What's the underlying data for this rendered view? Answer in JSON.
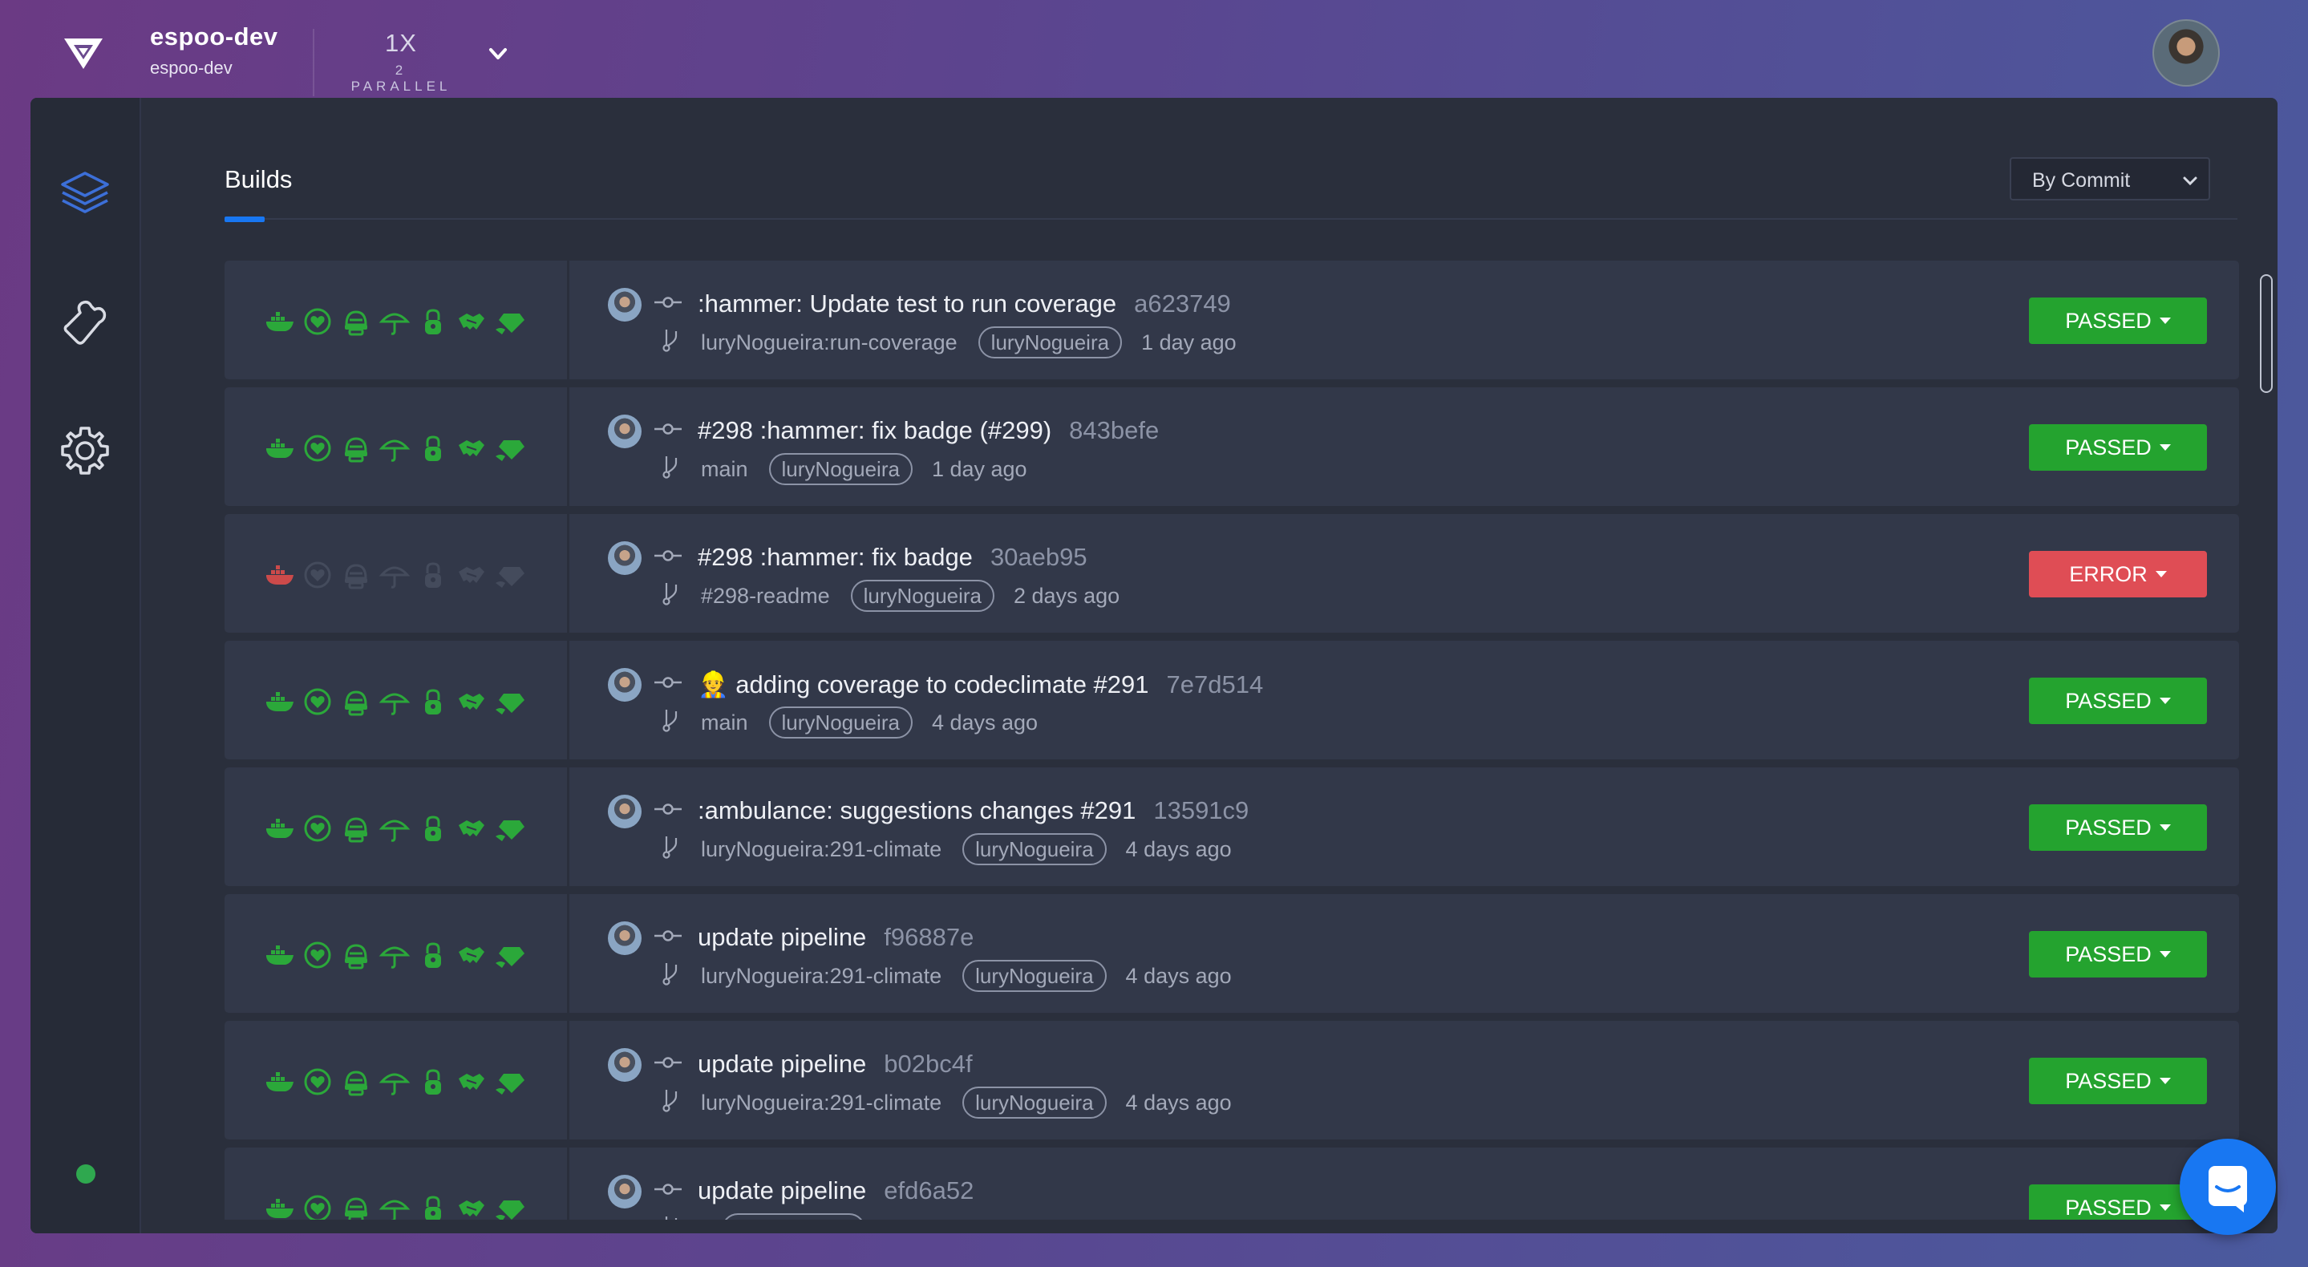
{
  "header": {
    "org_name": "espoo-dev",
    "org_sub": "espoo-dev",
    "plan_main": "1X",
    "plan_sub": "2 PARALLEL",
    "logo_icon": "heart-shield-logo-icon",
    "chevron_icon": "chevron-down-icon",
    "avatar": "user-avatar"
  },
  "sidebar": {
    "items": [
      {
        "icon": "layers-icon",
        "name": "builds",
        "active": true
      },
      {
        "icon": "puzzle-icon",
        "name": "integrations",
        "active": false
      },
      {
        "icon": "gear-icon",
        "name": "settings",
        "active": false
      }
    ],
    "status_color": "#2fa84f"
  },
  "main": {
    "tab_label": "Builds",
    "sort_select": {
      "value": "By Commit"
    }
  },
  "colors": {
    "passed": "#24a32f",
    "error": "#df4d55",
    "stage_ok": "#2ba83a",
    "stage_fail": "#cc4a4a",
    "stage_skipped": "#444b5c",
    "accent": "#1877f2"
  },
  "pipeline_stage_icons": [
    "docker-icon",
    "heart-shield-icon",
    "helmet-icon",
    "umbrella-icon",
    "lock-icon",
    "handshake-icon",
    "diamond-hand-icon"
  ],
  "builds": [
    {
      "message": ":hammer: Update test to run coverage",
      "sha": "a623749",
      "branch": "luryNogueira:run-coverage",
      "user": "luryNogueira",
      "when": "1 day ago",
      "status": "PASSED",
      "stages": [
        "ok",
        "ok",
        "ok",
        "ok",
        "ok",
        "ok",
        "ok"
      ]
    },
    {
      "message": "#298 :hammer: fix badge (#299)",
      "sha": "843befe",
      "branch": "main",
      "user": "luryNogueira",
      "when": "1 day ago",
      "status": "PASSED",
      "stages": [
        "ok",
        "ok",
        "ok",
        "ok",
        "ok",
        "ok",
        "ok"
      ]
    },
    {
      "message": "#298 :hammer: fix badge",
      "sha": "30aeb95",
      "branch": "#298-readme",
      "user": "luryNogueira",
      "when": "2 days ago",
      "status": "ERROR",
      "stages": [
        "fail",
        "skip",
        "skip",
        "skip",
        "skip",
        "skip",
        "skip"
      ]
    },
    {
      "message": "👷 adding coverage to codeclimate #291",
      "sha": "7e7d514",
      "branch": "main",
      "user": "luryNogueira",
      "when": "4 days ago",
      "status": "PASSED",
      "stages": [
        "ok",
        "ok",
        "ok",
        "ok",
        "ok",
        "ok",
        "ok"
      ]
    },
    {
      "message": ":ambulance: suggestions changes #291",
      "sha": "13591c9",
      "branch": "luryNogueira:291-climate",
      "user": "luryNogueira",
      "when": "4 days ago",
      "status": "PASSED",
      "stages": [
        "ok",
        "ok",
        "ok",
        "ok",
        "ok",
        "ok",
        "ok"
      ]
    },
    {
      "message": "update pipeline",
      "sha": "f96887e",
      "branch": "luryNogueira:291-climate",
      "user": "luryNogueira",
      "when": "4 days ago",
      "status": "PASSED",
      "stages": [
        "ok",
        "ok",
        "ok",
        "ok",
        "ok",
        "ok",
        "ok"
      ]
    },
    {
      "message": "update pipeline",
      "sha": "b02bc4f",
      "branch": "luryNogueira:291-climate",
      "user": "luryNogueira",
      "when": "4 days ago",
      "status": "PASSED",
      "stages": [
        "ok",
        "ok",
        "ok",
        "ok",
        "ok",
        "ok",
        "ok"
      ]
    },
    {
      "message": "update pipeline",
      "sha": "efd6a52",
      "branch": "",
      "user": "luryNogueira",
      "when": "",
      "status": "PASSED",
      "stages": [
        "ok",
        "ok",
        "ok",
        "ok",
        "ok",
        "ok",
        "ok"
      ]
    }
  ],
  "chat_widget": {
    "icon": "chat-bubble-icon"
  }
}
